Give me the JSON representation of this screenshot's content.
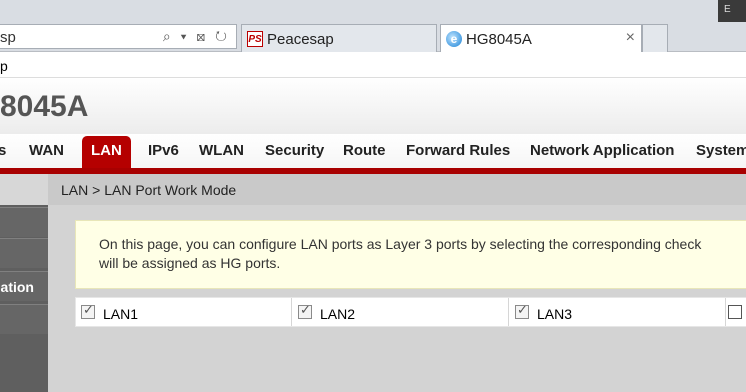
{
  "browser": {
    "address_text": "sp",
    "address_icons": "⌕ ▾ ⊠ ↻",
    "tabs": [
      {
        "label": "Peacesap",
        "icon": "peacesap-favicon",
        "icon_text": "PS"
      },
      {
        "label": "HG8045A",
        "icon": "ie-favicon",
        "icon_text": "e",
        "close": "×"
      }
    ],
    "top_right_label": "E"
  },
  "menubar": {
    "item": "p"
  },
  "header": {
    "model": "8045A"
  },
  "nav": {
    "items": [
      "s",
      "WAN",
      "LAN",
      "IPv6",
      "WLAN",
      "Security",
      "Route",
      "Forward Rules",
      "Network Application",
      "System"
    ],
    "active": "LAN"
  },
  "sidebar": {
    "items": [
      "",
      "",
      "ation",
      ""
    ]
  },
  "content": {
    "breadcrumb": "LAN > LAN Port Work Mode",
    "info_line1": "On this page, you can configure LAN ports as Layer 3 ports by selecting the corresponding check",
    "info_line2": "will be assigned as HG ports.",
    "ports": [
      {
        "label": "LAN1",
        "checked": true
      },
      {
        "label": "LAN2",
        "checked": true
      },
      {
        "label": "LAN3",
        "checked": true
      },
      {
        "label": "",
        "checked": false
      }
    ]
  },
  "colors": {
    "accent": "#b50000",
    "info_bg": "#ffffe6",
    "sidebar": "#666666"
  }
}
